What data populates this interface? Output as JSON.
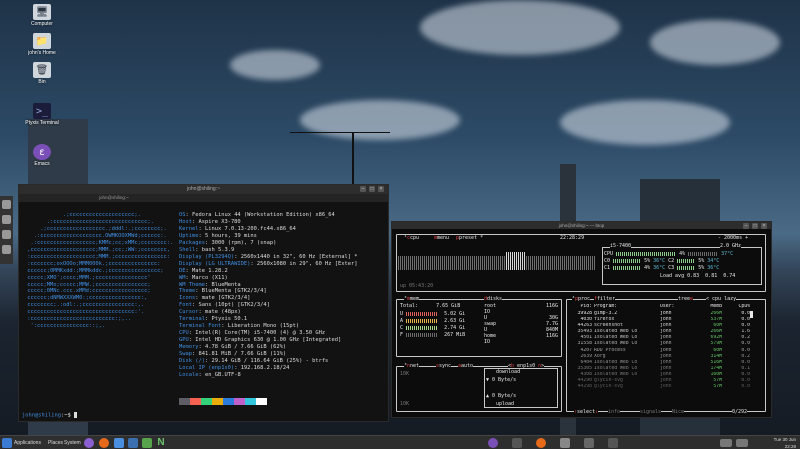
{
  "desktop": {
    "icons": [
      {
        "label": "Computer",
        "icon": "computer-icon",
        "glyph": "🖥"
      },
      {
        "label": "john's Home",
        "icon": "home-folder-icon",
        "glyph": "📁"
      },
      {
        "label": "Bin",
        "icon": "trash-icon",
        "glyph": "🗑"
      },
      {
        "label": "Ptyxis Terminal",
        "icon": "terminal-icon",
        "glyph": ">_"
      },
      {
        "label": "Emacs",
        "icon": "emacs-icon",
        "glyph": "ε"
      }
    ]
  },
  "terminal1": {
    "title": "john@shiling:~",
    "tab": "john@shiling:~",
    "logo_lines": [
      "            .;cccccccccccccccccccc;.",
      "       .:ccccccccccccccccccccccccccccc;.",
      "     .;cccccccccccccccccc.;dddl:.;cccccccc;.",
      "   .:ccccccccccccccccccc.OWMKOOXMWd;cccccc:.",
      "  .:cccccccccccccccccc;KMMc;cc;xMMc;cccccccc:.",
      " ,cccccccccccccccccccc;MMM.;cc;;WW:;cccccccc,",
      " :cccccccccccccccccccc;MMM.;cccccccccccccccc:",
      " :ccccccc;oxOOOo;MMM000k.;ccccccccccccccc:",
      " cccccc;0MMKxdd:;MMMkddc.;cccccccccccccccc;",
      " ccccc;XMO';cccc;MMM.;cccccccccccccccc'",
      " ccccc;MMo;ccccc;MMW.;cccccccccccccccc;",
      " ccccc;0MNc.ccc.xMMd;ccccccccccccccccc;",
      " cccccc;dNMWXXXWM0:;cccccccccccccccc:,",
      " cccccccc;.:odl:.;cccccccccccccccc:,.",
      " ccccccccccccccccccccccccccccccccc:'.",
      " :cccccccccccccccccccccccccc:;,..",
      "  ':cccccccccccccccc::;,."
    ],
    "header": "john@shiling",
    "info": [
      {
        "k": "OS",
        "v": "Fedora Linux 44 (Workstation Edition) x86_64"
      },
      {
        "k": "Host",
        "v": "Aspire X3-780"
      },
      {
        "k": "Kernel",
        "v": "Linux 7.0.13-200.fc44.x86_64"
      },
      {
        "k": "Uptime",
        "v": "5 hours, 39 mins"
      },
      {
        "k": "Packages",
        "v": "3000 (rpm), 7 (snap)"
      },
      {
        "k": "Shell",
        "v": "bash 5.3.9"
      },
      {
        "k": "Display (PL3294Q)",
        "v": "2560x1440 in 32\", 60 Hz [External] *"
      },
      {
        "k": "Display (LG ULTRAWIDE)",
        "v": "2560x1080 in 29\", 60 Hz [Exter]"
      },
      {
        "k": "DE",
        "v": "Mate 1.28.2"
      },
      {
        "k": "WM",
        "v": "Marco (X11)"
      },
      {
        "k": "WM Theme",
        "v": "BlueMenta"
      },
      {
        "k": "Theme",
        "v": "BlueMenta [GTK2/3/4]"
      },
      {
        "k": "Icons",
        "v": "mate [GTK2/3/4]"
      },
      {
        "k": "Font",
        "v": "Sans (10pt) [GTK2/3/4]"
      },
      {
        "k": "Cursor",
        "v": "mate (48px)"
      },
      {
        "k": "Terminal",
        "v": "Ptyxis 50.1"
      },
      {
        "k": "Terminal Font",
        "v": "Liberation Mono (15pt)"
      },
      {
        "k": "CPU",
        "v": "Intel(R) Core(TM) i5-7400 (4) @ 3.50 GHz"
      },
      {
        "k": "GPU",
        "v": "Intel HD Graphics 630 @ 1.00 GHz [Integrated]"
      },
      {
        "k": "Memory",
        "v": "4.78 GiB / 7.66 GiB (62%)"
      },
      {
        "k": "Swap",
        "v": "841.81 MiB / 7.66 GiB (11%)"
      },
      {
        "k": "Disk (/)",
        "v": "29.14 GiB / 116.64 GiB (25%) - btrfs"
      },
      {
        "k": "Local IP (enp1s0)",
        "v": "192.168.2.18/24"
      },
      {
        "k": "Locale",
        "v": "en_GB.UTF-8"
      }
    ],
    "palette": [
      "#2b2b2b",
      "#c01c28",
      "#26a269",
      "#a2734c",
      "#12488b",
      "#a347ba",
      "#2aa1b3",
      "#d0cfcc",
      "#5e5c64",
      "#f66151",
      "#33d17a",
      "#e9ad0c",
      "#2a7bde",
      "#c061cb",
      "#33c7de",
      "#ffffff"
    ],
    "prompt_user": "john@shiling",
    "prompt_rest": ":~$ "
  },
  "btop": {
    "title": "john@shiling:~ — btop",
    "cpu_title": "cpu",
    "menu_label": "menu",
    "preset_label": "preset *",
    "clock": "22:28:29",
    "interval": "2000ms",
    "cpu_model": "i5-7400",
    "freq": "2.0 GHz",
    "cpu_rows": [
      {
        "name": "CPU",
        "pct": "4%",
        "temp": "37°C"
      },
      {
        "name": "C0",
        "pct": "5%",
        "temp": "36°C",
        "name2": "C2",
        "pct2": "5%",
        "temp2": "34°C"
      },
      {
        "name": "C1",
        "pct": "4%",
        "temp": "36°C",
        "name2": "C3",
        "pct2": "5%",
        "temp2": "36°C"
      }
    ],
    "load_avg_label": "Load avg",
    "load_avg": "0.83  0.81  0.74",
    "uptime": "up 05:43:20",
    "mem_title": "mem",
    "mem_total_label": "Total:",
    "mem_total": "7.65 GiB",
    "mem_rows": [
      {
        "k": "U",
        "v": "5.02 Gi"
      },
      {
        "k": "A",
        "v": "2.63 Gi"
      },
      {
        "k": "C",
        "v": "2.74 Gi"
      },
      {
        "k": "F",
        "v": "267 MiB"
      }
    ],
    "disks_title": "disks",
    "disks": [
      {
        "name": "root",
        "size": "116G"
      },
      {
        "name": "IO",
        "size": ""
      },
      {
        "name": "U",
        "size": "30G"
      },
      {
        "name": "swap",
        "size": "7.7G"
      },
      {
        "name": "U",
        "size": "840M"
      },
      {
        "name": "home",
        "size": "116G"
      },
      {
        "name": "IO",
        "size": ""
      }
    ],
    "net_title": "net",
    "sync_label": "sync",
    "auto_label": "auto",
    "iface": "enp1s0",
    "net_scale": "10K",
    "download_label": "download",
    "download_rate": "0 Byte/s",
    "upload_rate": "0 Byte/s",
    "upload_label": "upload",
    "proc_title": "proc",
    "filter_label": "filter",
    "tree_label": "tree",
    "cpu_lazy": "cpu lazy",
    "proc_headers": [
      "Pid:",
      "Program:",
      "User:",
      "MemB",
      "Cpu%"
    ],
    "procs": [
      {
        "pid": "39928",
        "prog": "gimp-3.2",
        "user": "john",
        "mem": "266M",
        "cpu": "0.0"
      },
      {
        "pid": "4030",
        "prog": "firefox",
        "user": "john",
        "mem": "537M",
        "cpu": "0.0"
      },
      {
        "pid": "44263",
        "prog": "screenshot",
        "user": "john",
        "mem": "60M",
        "cpu": "0.0"
      },
      {
        "pid": "35493",
        "prog": "Isolated Web Co",
        "user": "john",
        "mem": "266M",
        "cpu": "1.6"
      },
      {
        "pid": "4501",
        "prog": "Isolated Web Co",
        "user": "john",
        "mem": "692M",
        "cpu": "0.2"
      },
      {
        "pid": "31558",
        "prog": "Isolated Web Co",
        "user": "john",
        "mem": "579M",
        "cpu": "0.0"
      },
      {
        "pid": "4207",
        "prog": "RDD Process",
        "user": "john",
        "mem": "60M",
        "cpu": "0.0"
      },
      {
        "pid": "2639",
        "prog": "Xorg",
        "user": "john",
        "mem": "314M",
        "cpu": "0.2"
      },
      {
        "pid": "6404",
        "prog": "Isolated Web Co",
        "user": "john",
        "mem": "516M",
        "cpu": "0.0"
      },
      {
        "pid": "35305",
        "prog": "Isolated Web Co",
        "user": "john",
        "mem": "174M",
        "cpu": "0.1"
      },
      {
        "pid": "4308",
        "prog": "Isolated Web Co",
        "user": "john",
        "mem": "160M",
        "cpu": "0.0"
      },
      {
        "pid": "44290",
        "prog": "glycin-svg",
        "user": "john",
        "mem": "57M",
        "cpu": "0.0"
      },
      {
        "pid": "44298",
        "prog": "glycin-svg",
        "user": "john",
        "mem": "57M",
        "cpu": "0.0"
      }
    ],
    "select_label": "select",
    "info_label": "info",
    "signals_label": "signals",
    "nice_label": "Nice",
    "count": "0/292"
  },
  "taskbar": {
    "applications": "Applications",
    "places": "Places",
    "system": "System",
    "date": "Tue 30 Jun",
    "time": "22:28"
  }
}
